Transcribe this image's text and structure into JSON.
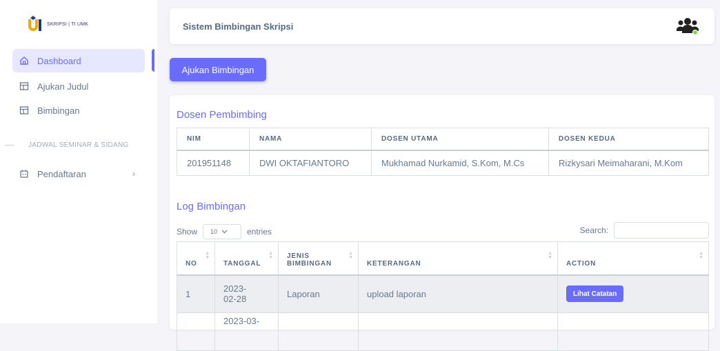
{
  "brand": {
    "logo_text": "SKRIPSI | TI UMK"
  },
  "sidebar": {
    "items": [
      {
        "label": "Dashboard",
        "icon": "home-icon",
        "active": true
      },
      {
        "label": "Ajukan Judul",
        "icon": "layout-icon"
      },
      {
        "label": "Bimbingan",
        "icon": "layout-icon"
      }
    ],
    "section_header": "JADWAL SEMINAR & SIDANG",
    "section_items": [
      {
        "label": "Pendaftaran",
        "icon": "calendar-icon",
        "chevron": "›"
      }
    ]
  },
  "navbar": {
    "title": "Sistem Bimbingan Skripsi",
    "icon": "users-icon"
  },
  "action_button": "Ajukan Bimbingan",
  "dosen": {
    "title": "Dosen Pembimbing",
    "headers": [
      "NIM",
      "NAMA",
      "DOSEN UTAMA",
      "DOSEN KEDUA"
    ],
    "row": [
      "201951148",
      "DWI OKTAFIANTORO",
      "Mukhamad Nurkamid, S.Kom, M.Cs",
      "Rizkysari Meimaharani, M.Kom"
    ]
  },
  "log": {
    "title": "Log Bimbingan",
    "show_label": "Show",
    "show_value": "10",
    "entries_label": "entries",
    "search_label": "Search:",
    "headers": [
      "NO",
      "TANGGAL",
      "JENIS BIMBINGAN",
      "KETERANGAN",
      "ACTION"
    ],
    "rows": [
      {
        "no": "1",
        "tanggal": "2023-02-28",
        "jenis": "Laporan",
        "keterangan": "upload laporan",
        "action": "Lihat Catatan"
      },
      {
        "no": "",
        "tanggal": "2023-03-",
        "jenis": "",
        "keterangan": "",
        "action": ""
      }
    ]
  },
  "colors": {
    "primary": "#696cff",
    "active_bg": "#e7e7ff",
    "status_online": "#71dd37"
  }
}
